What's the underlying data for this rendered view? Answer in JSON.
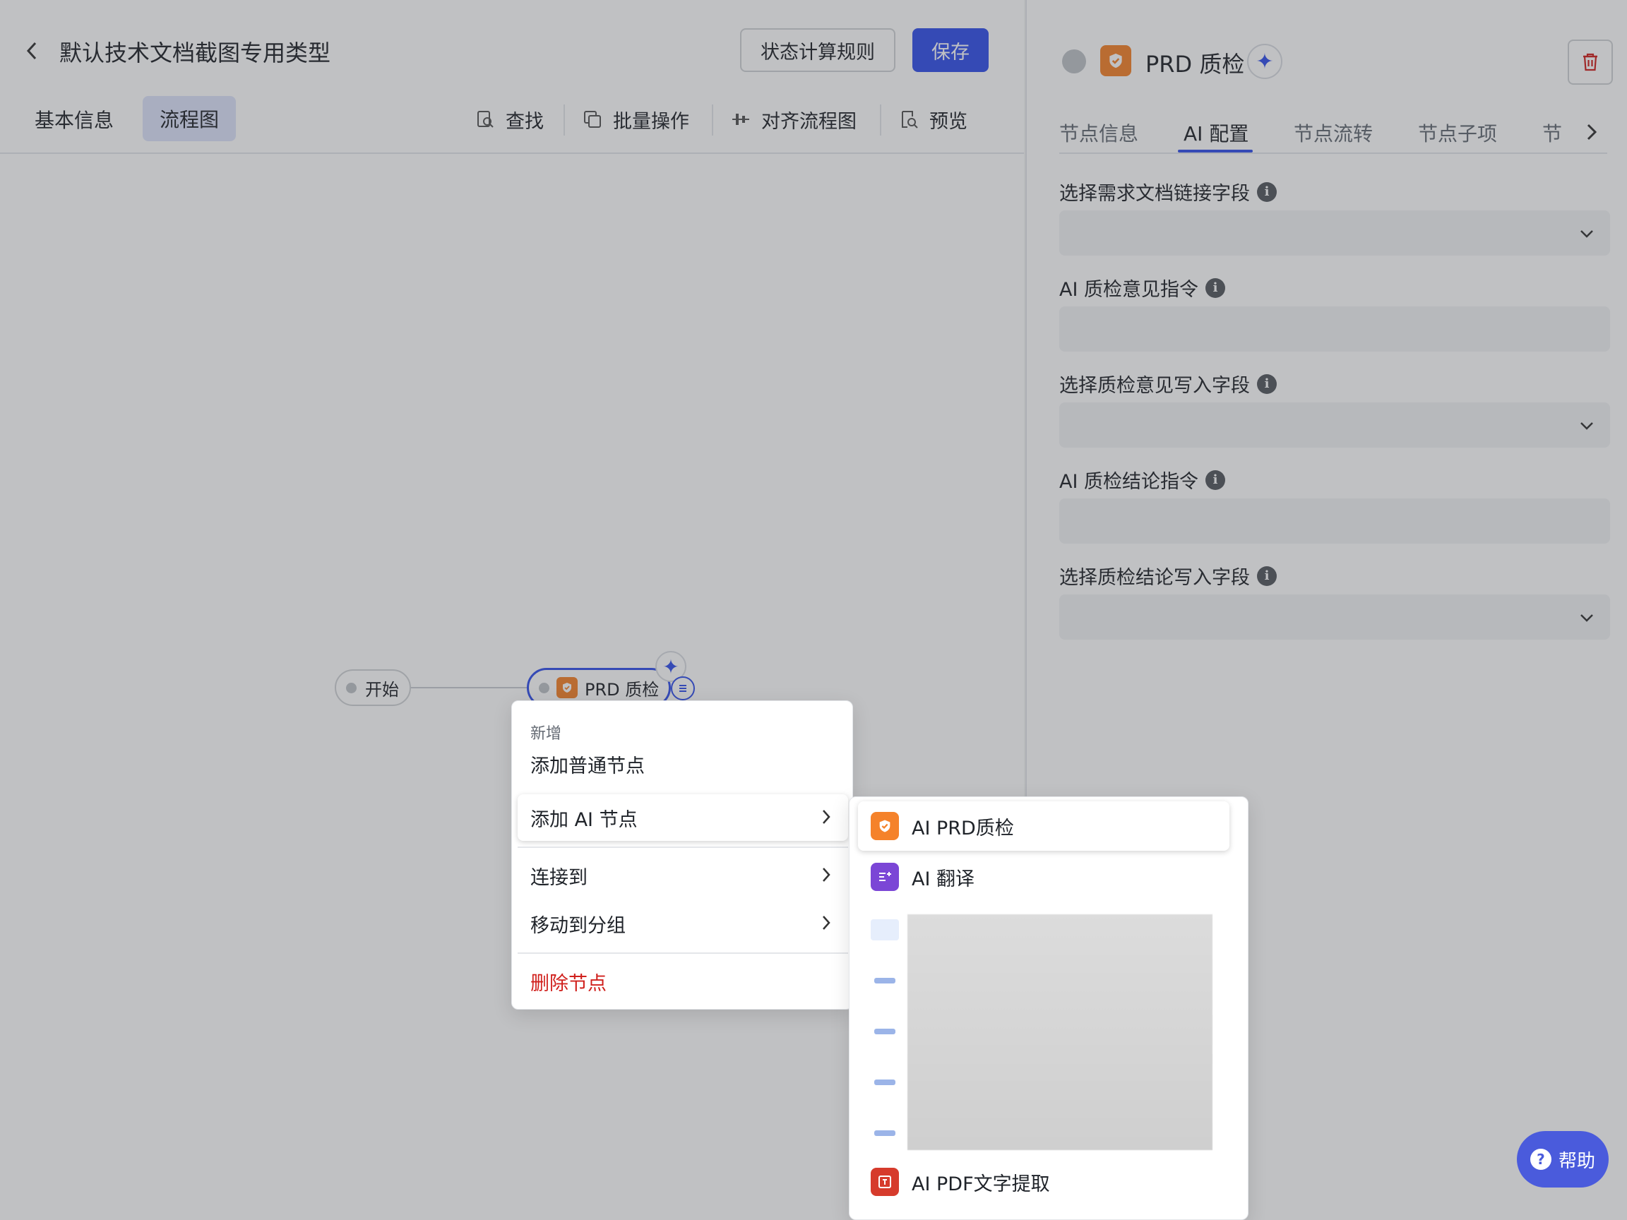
{
  "header": {
    "title": "默认技术文档截图专用类型",
    "rule_button": "状态计算规则",
    "save_button": "保存"
  },
  "tabs": {
    "basic": "基本信息",
    "flow": "流程图"
  },
  "toolbar": {
    "find": "查找",
    "batch": "批量操作",
    "align": "对齐流程图",
    "preview": "预览"
  },
  "canvas": {
    "start_node": "开始",
    "prd_node": "PRD 质检"
  },
  "context_menu": {
    "group_label": "新增",
    "add_normal": "添加普通节点",
    "add_ai": "添加 AI 节点",
    "connect": "连接到",
    "move_group": "移动到分组",
    "delete": "删除节点"
  },
  "submenu": {
    "items": [
      "AI PRD质检",
      "AI 翻译",
      "AI PDF文字提取"
    ]
  },
  "panel": {
    "title": "PRD 质检",
    "tabs": [
      "节点信息",
      "AI 配置",
      "节点流转",
      "节点子项",
      "节"
    ],
    "active_tab": "AI 配置",
    "fields": [
      {
        "label": "选择需求文档链接字段",
        "type": "select"
      },
      {
        "label": "AI 质检意见指令",
        "type": "input"
      },
      {
        "label": "选择质检意见写入字段",
        "type": "select"
      },
      {
        "label": "AI 质检结论指令",
        "type": "input"
      },
      {
        "label": "选择质检结论写入字段",
        "type": "select"
      }
    ]
  },
  "help": {
    "label": "帮助"
  },
  "colors": {
    "accent": "#3350eb",
    "orange": "#f5822a",
    "purple": "#7b46d6",
    "danger": "#d0201c"
  }
}
